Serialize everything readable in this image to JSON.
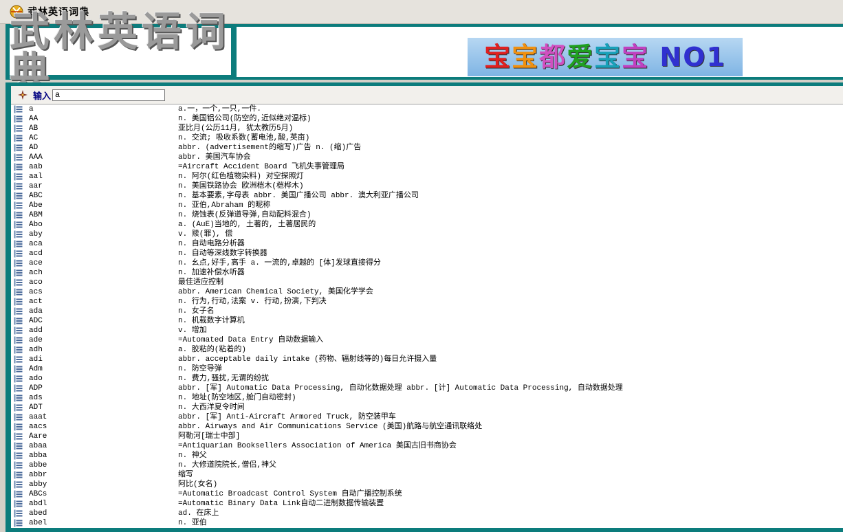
{
  "window": {
    "title": "武林英语词典"
  },
  "banner": {
    "logo_text": "武林英语词典",
    "ad_text_parts": [
      "宝",
      "宝",
      "都",
      "爱",
      "宝",
      "宝",
      " NO1"
    ]
  },
  "search": {
    "label": "输入",
    "value": "a"
  },
  "entries": [
    {
      "word": "a",
      "def": "a.一，一个,一只,一件."
    },
    {
      "word": "AA",
      "def": "n. 美国铝公司(防空的,近似绝对温标)"
    },
    {
      "word": "AB",
      "def": "亚比月(公历11月, 犹太教历5月)"
    },
    {
      "word": "AC",
      "def": "n. 交流; 吸收系数(蓄电池,酸,英亩)"
    },
    {
      "word": "AD",
      "def": "abbr. (advertisement的缩写)广告  n. (缩)广告"
    },
    {
      "word": "AAA",
      "def": "abbr. 美国汽车协会"
    },
    {
      "word": "aab",
      "def": "=Aircraft Accident Board 飞机失事管理局"
    },
    {
      "word": "aal",
      "def": "n. 阿尔(红色植物染料)  对空探照灯"
    },
    {
      "word": "aar",
      "def": "n. 美国铁路协会  欧洲桤木(桤桦木)"
    },
    {
      "word": "ABC",
      "def": "n. 基本要素,字母表  abbr. 美国广播公司  abbr. 澳大利亚广播公司"
    },
    {
      "word": "Abe",
      "def": "n. 亚伯,Abraham 的昵称"
    },
    {
      "word": "ABM",
      "def": "n. 烧蚀表(反弹道导弹,自动配料混合)"
    },
    {
      "word": "Abo",
      "def": "a. (AuE)当地的, 土著的, 土著居民的"
    },
    {
      "word": "aby",
      "def": "v. 赎(罪), 偿"
    },
    {
      "word": "aca",
      "def": "n. 自动电路分析器"
    },
    {
      "word": "acd",
      "def": "n. 自动等深线数字转换器"
    },
    {
      "word": "ace",
      "def": "n. 幺点,好手,高手  a. 一流的,卓越的  [体]发球直接得分"
    },
    {
      "word": "ach",
      "def": "n. 加速补偿水听器"
    },
    {
      "word": "aco",
      "def": "最佳适应控制"
    },
    {
      "word": "acs",
      "def": "abbr. American Chemical Society, 美国化学学会"
    },
    {
      "word": "act",
      "def": "n. 行为,行动,法案  v. 行动,扮演,下判决"
    },
    {
      "word": "ada",
      "def": "n. 女子名"
    },
    {
      "word": "ADC",
      "def": "n. 机载数字计算机"
    },
    {
      "word": "add",
      "def": "v. 增加"
    },
    {
      "word": "ade",
      "def": "=Automated Data Entry 自动数据输入"
    },
    {
      "word": "adh",
      "def": "a. 胶粘的(粘着的)"
    },
    {
      "word": "adi",
      "def": "abbr. acceptable daily intake (药物、辐射线等的)每日允许摄入量"
    },
    {
      "word": "Adm",
      "def": "n. 防空导弹"
    },
    {
      "word": "ado",
      "def": "n. 费力,骚扰,无谓的纷扰"
    },
    {
      "word": "ADP",
      "def": "abbr. [军] Automatic Data Processing, 自动化数据处理  abbr. [计] Automatic Data Processing, 自动数据处理"
    },
    {
      "word": "ads",
      "def": "n. 地址(防空地区,舱门自动密封)"
    },
    {
      "word": "ADT",
      "def": "n. 大西洋夏令时间"
    },
    {
      "word": "aaat",
      "def": "abbr. [军] Anti-Aircraft Armored Truck, 防空装甲车"
    },
    {
      "word": "aacs",
      "def": "abbr. Airways and Air Communications Service (美国)航路与航空通讯联络处"
    },
    {
      "word": "Aare",
      "def": "阿勒河[瑞士中部]"
    },
    {
      "word": "abaa",
      "def": "=Antiquarian Booksellers Association of America 美国古旧书商协会"
    },
    {
      "word": "abba",
      "def": "n. 神父"
    },
    {
      "word": "abbe",
      "def": "n. 大修道院院长,僧侣,神父"
    },
    {
      "word": "abbr",
      "def": "缩写"
    },
    {
      "word": "abby",
      "def": "阿比(女名)"
    },
    {
      "word": "ABCs",
      "def": "=Automatic Broadcast Control System 自动广播控制系统"
    },
    {
      "word": "abdl",
      "def": "=Automatic Binary Data Link自动二进制数据传输装置"
    },
    {
      "word": "abed",
      "def": "ad. 在床上"
    },
    {
      "word": "abel",
      "def": "n. 亚伯"
    }
  ]
}
